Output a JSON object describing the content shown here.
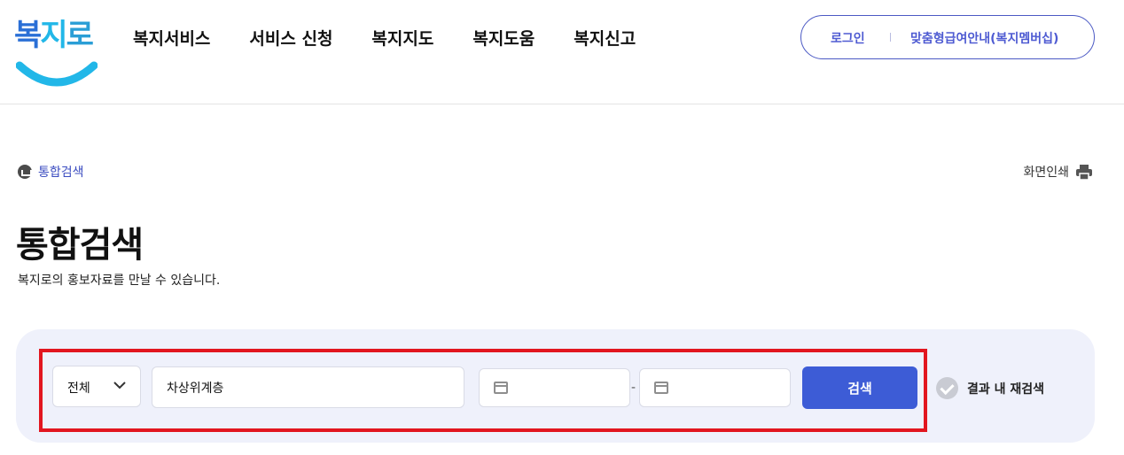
{
  "header": {
    "logo": "복지로",
    "nav": [
      "복지서비스",
      "서비스 신청",
      "복지지도",
      "복지도움",
      "복지신고"
    ],
    "util": {
      "login": "로그인",
      "member": "맞춤형급여안내(복지멤버십)"
    }
  },
  "breadcrumb": {
    "label": "통합검색",
    "icon": "home-icon"
  },
  "print": {
    "label": "화면인쇄",
    "icon": "printer-icon"
  },
  "page": {
    "title": "통합검색",
    "description": "복지로의 홍보자료를 만날 수 있습니다."
  },
  "search": {
    "category": "전체",
    "keyword": "차상위계층",
    "date_separator": "-",
    "button": "검색",
    "research_label": "결과 내 재검색"
  },
  "colors": {
    "accent": "#3d5cd6",
    "panel": "#eff1fb",
    "highlight": "#e2161f",
    "util_text": "#4e5bd2"
  }
}
